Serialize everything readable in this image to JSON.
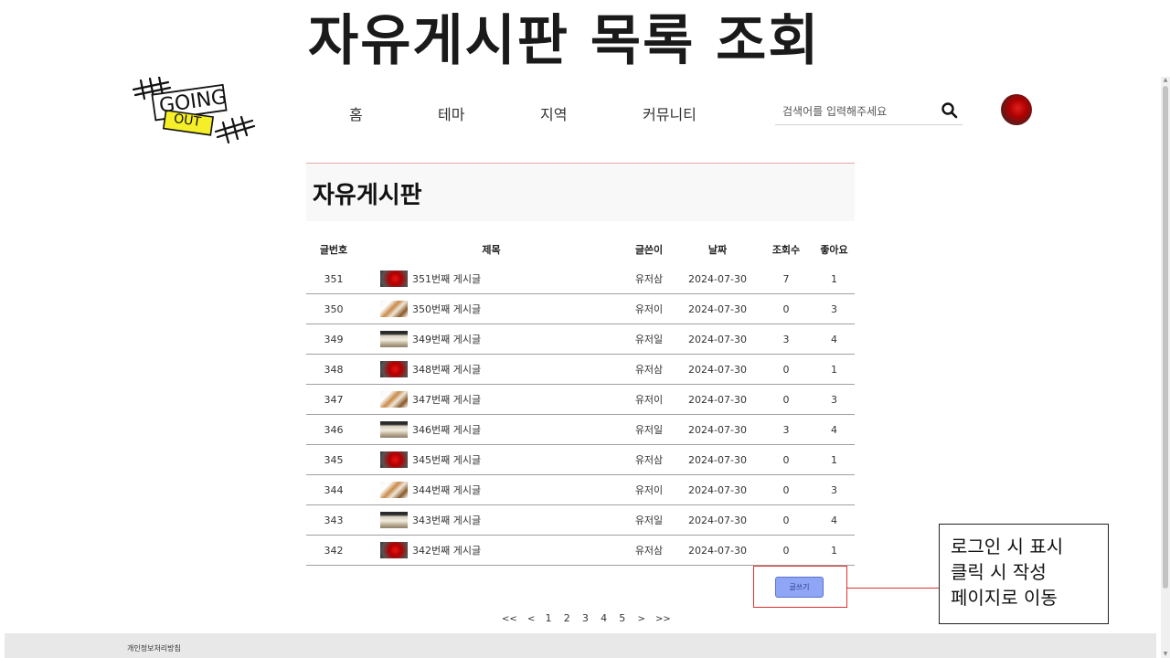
{
  "slide": {
    "title": "자유게시판 목록 조회"
  },
  "logo": {
    "top_text": "GOING",
    "bottom_text": "OUT"
  },
  "nav": {
    "items": [
      {
        "label": "홈"
      },
      {
        "label": "테마"
      },
      {
        "label": "지역"
      },
      {
        "label": "커뮤니티"
      }
    ]
  },
  "search": {
    "placeholder": "검색어를 입력해주세요",
    "icon": "search-icon"
  },
  "user": {
    "avatar_icon": "avatar"
  },
  "board": {
    "title": "자유게시판",
    "columns": [
      "글번호",
      "제목",
      "글쓴이",
      "날짜",
      "조회수",
      "좋아요"
    ],
    "rows": [
      {
        "no": "351",
        "thumb": "rose",
        "title": "351번째 게시글",
        "author": "유저삼",
        "date": "2024-07-30",
        "views": "7",
        "likes": "1"
      },
      {
        "no": "350",
        "thumb": "dog",
        "title": "350번째 게시글",
        "author": "유저이",
        "date": "2024-07-30",
        "views": "0",
        "likes": "3"
      },
      {
        "no": "349",
        "thumb": "bread",
        "title": "349번째 게시글",
        "author": "유저일",
        "date": "2024-07-30",
        "views": "3",
        "likes": "4"
      },
      {
        "no": "348",
        "thumb": "rose",
        "title": "348번째 게시글",
        "author": "유저삼",
        "date": "2024-07-30",
        "views": "0",
        "likes": "1"
      },
      {
        "no": "347",
        "thumb": "dog",
        "title": "347번째 게시글",
        "author": "유저이",
        "date": "2024-07-30",
        "views": "0",
        "likes": "3"
      },
      {
        "no": "346",
        "thumb": "bread",
        "title": "346번째 게시글",
        "author": "유저일",
        "date": "2024-07-30",
        "views": "3",
        "likes": "4"
      },
      {
        "no": "345",
        "thumb": "rose",
        "title": "345번째 게시글",
        "author": "유저삼",
        "date": "2024-07-30",
        "views": "0",
        "likes": "1"
      },
      {
        "no": "344",
        "thumb": "dog",
        "title": "344번째 게시글",
        "author": "유저이",
        "date": "2024-07-30",
        "views": "0",
        "likes": "3"
      },
      {
        "no": "343",
        "thumb": "bread",
        "title": "343번째 게시글",
        "author": "유저일",
        "date": "2024-07-30",
        "views": "0",
        "likes": "4"
      },
      {
        "no": "342",
        "thumb": "rose",
        "title": "342번째 게시글",
        "author": "유저삼",
        "date": "2024-07-30",
        "views": "0",
        "likes": "1"
      }
    ],
    "write_button": "글쓰기"
  },
  "annotation": {
    "note": "로그인 시 표시 클릭 시 작성 페이지로 이동"
  },
  "pagination": {
    "first": "<<",
    "prev": "<",
    "pages": [
      "1",
      "2",
      "3",
      "4",
      "5"
    ],
    "next": ">",
    "last": ">>"
  },
  "footer": {
    "privacy_link": "개인정보처리방침"
  }
}
